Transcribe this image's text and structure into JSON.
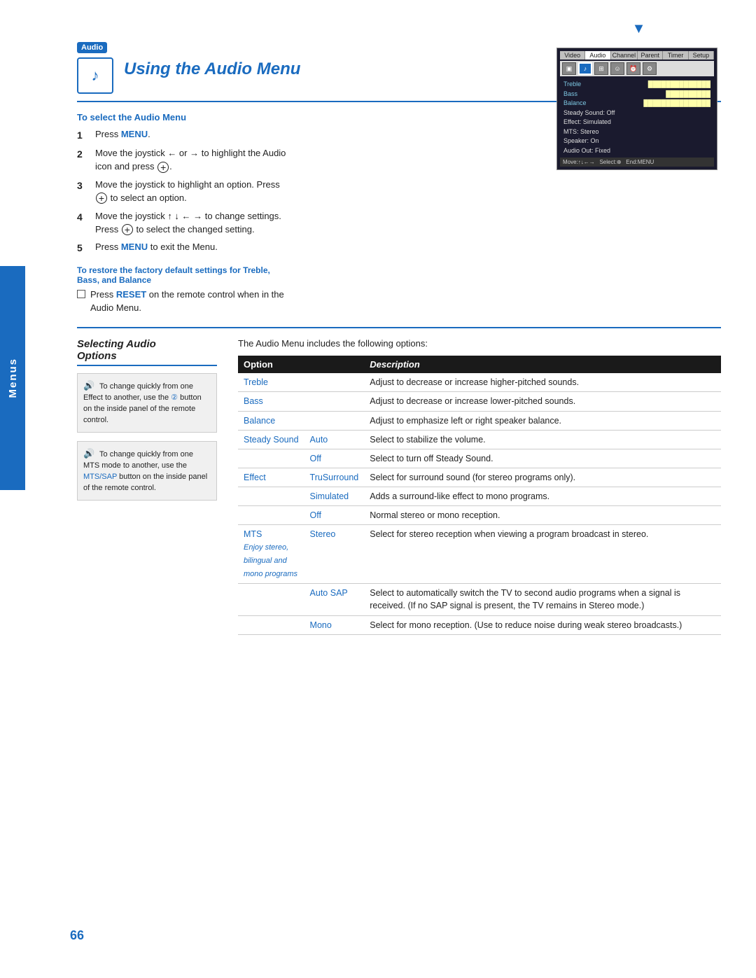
{
  "page": {
    "number": "66",
    "menus_tab_label": "Menus"
  },
  "header": {
    "badge": "Audio",
    "title": "Using the Audio Menu",
    "to_select_heading": "To select the Audio Menu"
  },
  "steps": [
    {
      "num": "1",
      "text": "Press ",
      "highlight": "MENU",
      "rest": "."
    },
    {
      "num": "2",
      "text": "Move the joystick ← or → to highlight the Audio icon and press ⊕."
    },
    {
      "num": "3",
      "text": "Move the joystick to highlight an option. Press ⊕ to select an option."
    },
    {
      "num": "4",
      "text": "Move the joystick ↑ ↓ ← → to change settings. Press ⊕ to select the changed setting."
    },
    {
      "num": "5",
      "text": "Press ",
      "highlight": "MENU",
      "rest": " to exit the Menu."
    }
  ],
  "factory_reset": {
    "heading": "To restore the factory default settings for Treble, Bass, and Balance",
    "text": "Press ",
    "highlight": "RESET",
    "rest": " on the remote control when in the Audio Menu."
  },
  "tv_mockup": {
    "tabs": [
      "Video",
      "Audio",
      "Channel",
      "Parent",
      "Timer",
      "Setup"
    ],
    "menu_rows": [
      {
        "label": "Treble",
        "value": "||||||||||||||||"
      },
      {
        "label": "Bass",
        "value": "||||||||||||"
      },
      {
        "label": "Balance",
        "value": "||||||||||||||||"
      },
      {
        "label": "Steady Sound: Off",
        "value": ""
      },
      {
        "label": "Effect: Simulated",
        "value": ""
      },
      {
        "label": "MTS: Stereo",
        "value": ""
      },
      {
        "label": "Speaker: On",
        "value": ""
      },
      {
        "label": "Audio Out: Fixed",
        "value": ""
      }
    ],
    "footer": "Move:↑↓←→  Select:⊕  End:MENU"
  },
  "selecting": {
    "title": "Selecting Audio Options",
    "intro": "The Audio Menu includes the following options:"
  },
  "notes": [
    {
      "text": "To change quickly from one Effect to another, use the ② button on the inside panel of the remote control."
    },
    {
      "text": "To change quickly from one MTS mode to another, use the MTS/SAP button on the inside panel of the remote control.",
      "highlight": "MTS/SAP"
    }
  ],
  "table": {
    "headers": [
      "Option",
      "Description"
    ],
    "rows": [
      {
        "option": "Treble",
        "sub": null,
        "description": "Adjust to decrease or increase higher-pitched sounds."
      },
      {
        "option": "Bass",
        "sub": null,
        "description": "Adjust to decrease or increase lower-pitched sounds."
      },
      {
        "option": "Balance",
        "sub": null,
        "description": "Adjust to emphasize left or right speaker balance."
      },
      {
        "option": "Steady Sound",
        "sub": "Auto",
        "description": "Select to stabilize the volume."
      },
      {
        "option": "",
        "sub": "Off",
        "description": "Select to turn off Steady Sound."
      },
      {
        "option": "Effect",
        "sub": "TruSurround",
        "description": "Select for surround sound (for stereo programs only)."
      },
      {
        "option": "",
        "sub": "Simulated",
        "description": "Adds a surround-like effect to mono programs."
      },
      {
        "option": "",
        "sub": "Off",
        "description": "Normal stereo or mono reception."
      },
      {
        "option": "MTS",
        "sub": "Stereo",
        "description": "Select for stereo reception when viewing a program broadcast in stereo.",
        "mts_italic": "Enjoy stereo, bilingual and mono programs"
      },
      {
        "option": "",
        "sub": "Auto SAP",
        "description": "Select to automatically switch the TV to second audio programs when a signal is received. (If no SAP signal is present, the TV remains in Stereo mode.)"
      },
      {
        "option": "",
        "sub": "Mono",
        "description": "Select for mono reception. (Use to reduce noise during weak stereo broadcasts.)"
      }
    ]
  }
}
